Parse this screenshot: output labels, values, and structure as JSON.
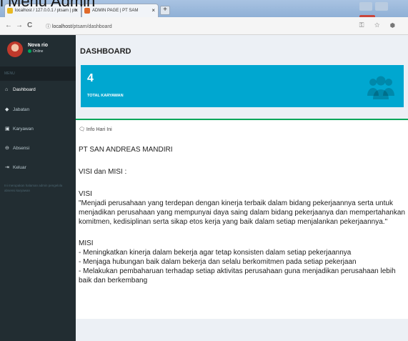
{
  "caption": "i Menu Admin",
  "browser": {
    "tabs": [
      {
        "label": "localhost / 127.0.0.1 / ptsam | ph"
      },
      {
        "label": "ADMIN PAGE | PT SAM"
      }
    ],
    "new_tab": "+",
    "nav": {
      "back": "←",
      "forward": "→",
      "reload": "C"
    },
    "address": {
      "info_icon": "ⓘ",
      "host": "localhost",
      "path": "/ptsam/dashboard"
    },
    "right_icons": "⚿ ☆ ⬢"
  },
  "sidebar": {
    "user": {
      "name": "Nova rio",
      "status": "Online"
    },
    "menu_header": "MENU",
    "items": [
      {
        "icon": "home-icon",
        "glyph": "⌂",
        "label": "Dashboard"
      },
      {
        "icon": "tag-icon",
        "glyph": "◆",
        "label": "Jabatan"
      },
      {
        "icon": "card-icon",
        "glyph": "▣",
        "label": "Karyawan"
      },
      {
        "icon": "attendance-icon",
        "glyph": "⊖",
        "label": "Absensi"
      },
      {
        "icon": "logout-icon",
        "glyph": "⇥",
        "label": "Keluar"
      }
    ],
    "note": "Ini merupakan halaman admin pengelola absensi karyawan"
  },
  "main": {
    "title": "DASHBOARD",
    "infobox": {
      "value": "4",
      "label": "TOTAL KARYAWAN",
      "icon": "users-icon",
      "color": "#00a7d0"
    },
    "panel": {
      "header": "Info Hari Ini",
      "company": "PT SAN ANDREAS MANDIRI",
      "visi_misi": "VISI dan MISI :",
      "visi": "VISI\n\"Menjadi perusahaan yang terdepan dengan kinerja terbaik dalam bidang pekerjaannya serta untuk menjadikan perusahaan yang mempunyai daya saing dalam bidang pekerjaanya dan mempertahankan komitmen, kedisiplinan serta sikap etos kerja yang baik dalam setiap menjalankan pekerjaannya.\"",
      "misi": "MISI\n- Meningkatkan kinerja dalam bekerja agar tetap konsisten dalam setiap pekerjaannya\n- Menjaga hubungan baik dalam bekerja dan selalu berkomitmen pada setiap pekerjaan\n- Melakukan pembaharuan terhadap setiap aktivitas perusahaan guna menjadikan perusahaan lebih baik dan berkembang"
    }
  }
}
